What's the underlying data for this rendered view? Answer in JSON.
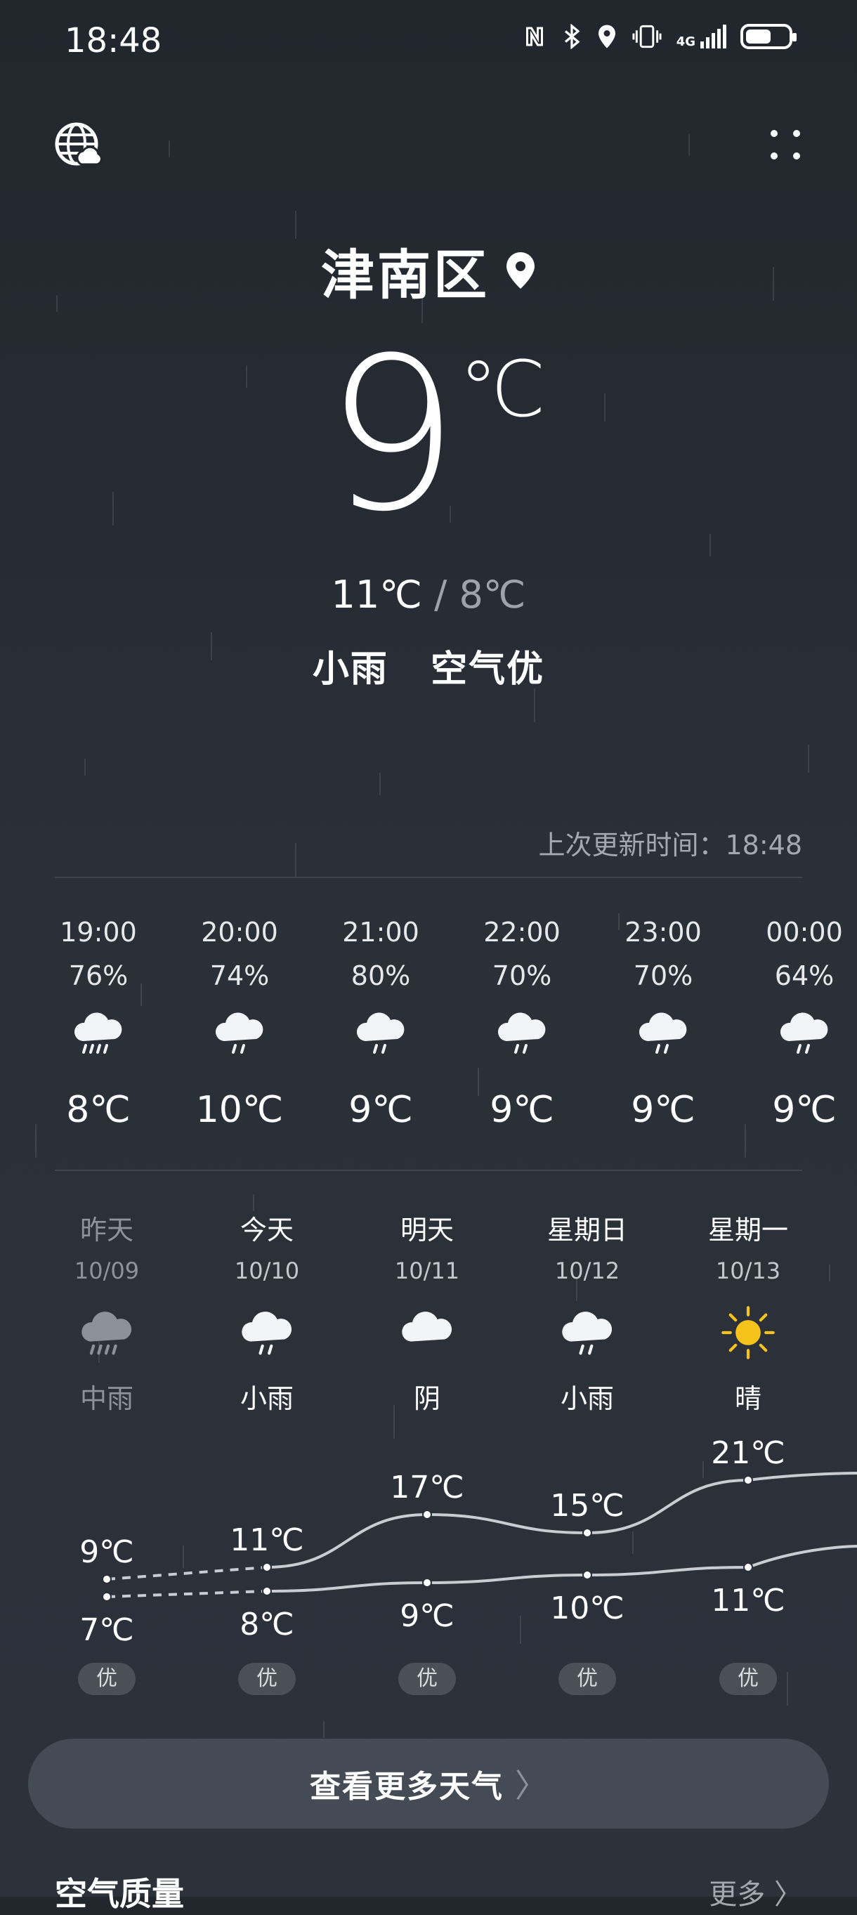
{
  "status_bar": {
    "time": "18:48",
    "icons": [
      "nfc-icon",
      "bluetooth-icon",
      "location-icon",
      "vibrate-icon",
      "signal-4g-icon",
      "battery-icon"
    ],
    "network_label": "4G",
    "battery_level": 0.6
  },
  "header": {
    "left_icon": "globe-cloud-icon",
    "right_icon": "more-dots-icon"
  },
  "current": {
    "city": "津南区",
    "temperature": "9",
    "unit": "℃",
    "high": "11℃",
    "separator": "/",
    "low": "8℃",
    "condition": "小雨",
    "air_quality": "空气优"
  },
  "updated": "上次更新时间：18:48",
  "hourly": [
    {
      "time": "19:00",
      "humidity": "76%",
      "icon": "heavy-rain-cloud-icon",
      "temp": "8℃"
    },
    {
      "time": "20:00",
      "humidity": "74%",
      "icon": "light-rain-cloud-icon",
      "temp": "10℃"
    },
    {
      "time": "21:00",
      "humidity": "80%",
      "icon": "light-rain-cloud-icon",
      "temp": "9℃"
    },
    {
      "time": "22:00",
      "humidity": "70%",
      "icon": "light-rain-cloud-icon",
      "temp": "9℃"
    },
    {
      "time": "23:00",
      "humidity": "70%",
      "icon": "light-rain-cloud-icon",
      "temp": "9℃"
    },
    {
      "time": "00:00",
      "humidity": "64%",
      "icon": "light-rain-cloud-icon",
      "temp": "9℃"
    }
  ],
  "daily": [
    {
      "name": "昨天",
      "date": "10/09",
      "icon": "moderate-rain-cloud-icon",
      "condition": "中雨",
      "high": 9,
      "low": 7,
      "high_label": "9℃",
      "low_label": "7℃",
      "aqi": "优",
      "past": true
    },
    {
      "name": "今天",
      "date": "10/10",
      "icon": "light-rain-cloud-icon",
      "condition": "小雨",
      "high": 11,
      "low": 8,
      "high_label": "11℃",
      "low_label": "8℃",
      "aqi": "优",
      "past": false
    },
    {
      "name": "明天",
      "date": "10/11",
      "icon": "cloudy-icon",
      "condition": "阴",
      "high": 17,
      "low": 9,
      "high_label": "17℃",
      "low_label": "9℃",
      "aqi": "优",
      "past": false
    },
    {
      "name": "星期日",
      "date": "10/12",
      "icon": "light-rain-cloud-icon",
      "condition": "小雨",
      "high": 15,
      "low": 10,
      "high_label": "15℃",
      "low_label": "10℃",
      "aqi": "优",
      "past": false
    },
    {
      "name": "星期一",
      "date": "10/13",
      "icon": "sun-icon",
      "condition": "晴",
      "high": 21,
      "low": 11,
      "high_label": "21℃",
      "low_label": "11℃",
      "aqi": "优",
      "past": false
    }
  ],
  "chart_data": {
    "type": "line",
    "categories": [
      "10/09",
      "10/10",
      "10/11",
      "10/12",
      "10/13"
    ],
    "series": [
      {
        "values": [
          9,
          11,
          17,
          15,
          21
        ]
      },
      {
        "values": [
          7,
          8,
          9,
          10,
          11
        ]
      }
    ],
    "grid": false
  },
  "more_weather_button": "查看更多天气",
  "air_quality_section": {
    "title": "空气质量",
    "more": "更多"
  },
  "colors": {
    "background": "#262a31",
    "sun": "#f6c21c",
    "muted_text": "#a4a9b1"
  }
}
